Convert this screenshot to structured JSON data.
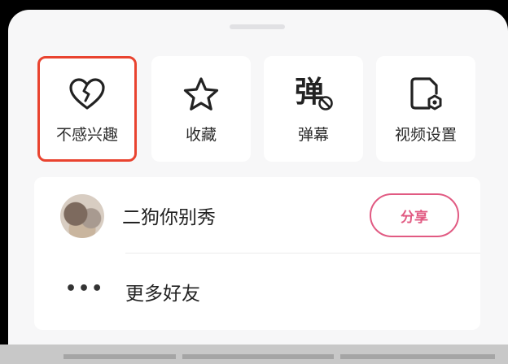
{
  "sheet": {
    "actions": [
      {
        "label": "不感兴趣",
        "icon": "broken-heart-icon",
        "selected": true
      },
      {
        "label": "收藏",
        "icon": "star-icon",
        "selected": false
      },
      {
        "label": "弹幕",
        "icon": "danmaku-off-icon",
        "glyph": "弹",
        "selected": false
      },
      {
        "label": "视频设置",
        "icon": "video-settings-icon",
        "selected": false
      }
    ],
    "friends": [
      {
        "name": "二狗你别秀",
        "share_label": "分享"
      }
    ],
    "more_friends": {
      "dots": "•••",
      "label": "更多好友"
    }
  },
  "colors": {
    "highlight_border": "#e9432f",
    "share_accent": "#e15a82",
    "sheet_background": "#f7f7f8"
  }
}
